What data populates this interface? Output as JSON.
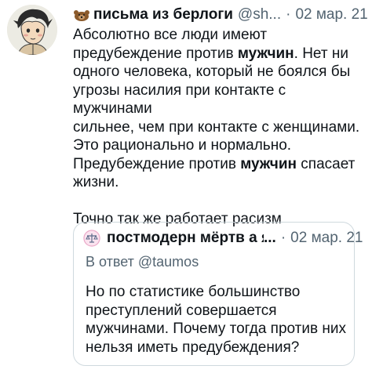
{
  "tweet": {
    "author_name": "письма из берлоги",
    "author_handle": "@sh...",
    "separator": "·",
    "date": "02 мар. 21",
    "lines": [
      "Абсолютно все люди имеют",
      "предубеждение против ",
      "мужчин",
      ". Нет ни",
      "одного человека, который не боялся бы",
      "угрозы насилия при контакте с мужчинами",
      "сильнее, чем при контакте с женщинами.",
      "Это рационально и нормально.",
      "Предубеждение против ",
      "мужчин",
      " спасает",
      "жизни.",
      "Точно так же работает расизм"
    ]
  },
  "quote": {
    "author_name": "постмодерн мёртв а я",
    "ellipsis": "...",
    "separator": "·",
    "date": "02 мар. 21",
    "reply_prefix": "В ответ ",
    "reply_handle": "@taumos",
    "lines": [
      "Но по статистике большинство",
      "преступлений совершается",
      "мужчинами. Почему тогда против них",
      "нельзя иметь предубеждения?"
    ]
  },
  "icons": {
    "author_avatar": "illustrated-person-avatar",
    "name_emoji": "bear-icon",
    "quote_avatar": "scale-icon"
  },
  "colors": {
    "text": "#0f1419",
    "secondary": "#536471",
    "border": "#cfd9de"
  }
}
